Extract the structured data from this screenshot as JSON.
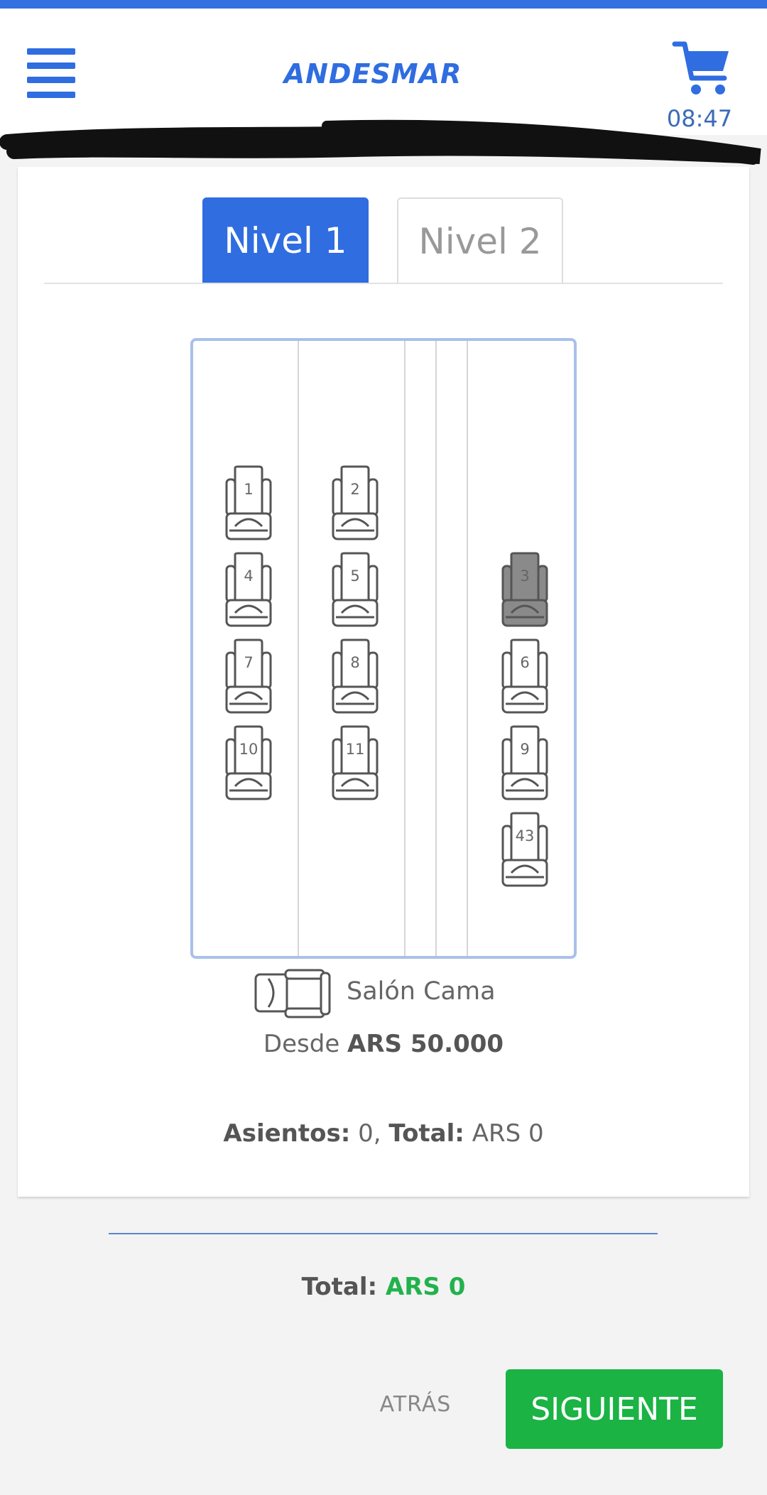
{
  "header": {
    "brand": "ANDESMAR",
    "timer": "08:47"
  },
  "tabs": [
    {
      "label": "Nivel 1",
      "active": true
    },
    {
      "label": "Nivel 2",
      "active": false
    }
  ],
  "seats": [
    {
      "number": "1",
      "status": "available"
    },
    {
      "number": "2",
      "status": "available"
    },
    {
      "number": "4",
      "status": "available"
    },
    {
      "number": "5",
      "status": "available"
    },
    {
      "number": "3",
      "status": "occupied"
    },
    {
      "number": "7",
      "status": "available"
    },
    {
      "number": "8",
      "status": "available"
    },
    {
      "number": "6",
      "status": "available"
    },
    {
      "number": "10",
      "status": "available"
    },
    {
      "number": "11",
      "status": "available"
    },
    {
      "number": "9",
      "status": "available"
    },
    {
      "number": "43",
      "status": "available"
    }
  ],
  "legend": {
    "seat_type": "Salón Cama",
    "price_prefix": "Desde",
    "price": "ARS 50.000"
  },
  "summary": {
    "seats_label": "Asientos:",
    "seats_value": "0,",
    "total_label": "Total:",
    "total_value": "ARS 0"
  },
  "footer": {
    "total_label": "Total:",
    "total_value": "ARS 0",
    "back_label": "ATRÁS",
    "next_label": "SIGUIENTE"
  },
  "colors": {
    "brand": "#2f6de0",
    "occupied_seat": "#8a8a8a",
    "available_seat": "#ffffff",
    "next_button": "#1ab344",
    "total_amount": "#22b24c"
  }
}
